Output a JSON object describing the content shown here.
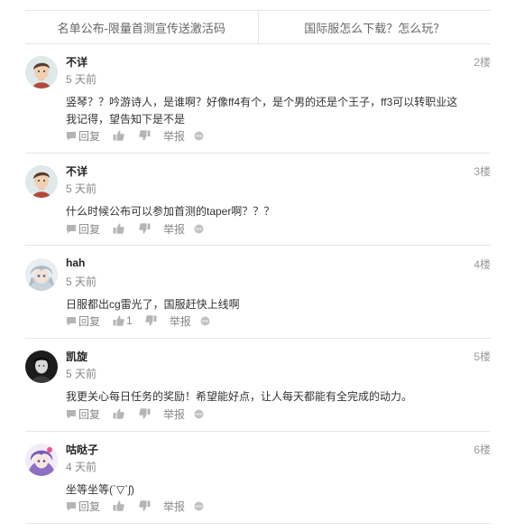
{
  "top_nav": {
    "left_link": "名单公布-限量首测宣传送激活码",
    "right_link": "国际服怎么下载？怎么玩？"
  },
  "comments": [
    {
      "username": "不详",
      "time": "5 天前",
      "floor": "2楼",
      "text": "竖琴？？吟游诗人，是谁啊？好像ff4有个，是个男的还是个王子，ff3可以转职业这我记得，望告知下是不是",
      "reply_label": "回复",
      "like_count": "",
      "report_label": "举报",
      "avatar_icon": "anime-boy-avatar"
    },
    {
      "username": "不详",
      "time": "5 天前",
      "floor": "3楼",
      "text": "什么时候公布可以参加首测的taper啊？？？",
      "reply_label": "回复",
      "like_count": "",
      "report_label": "举报",
      "avatar_icon": "anime-boy-avatar"
    },
    {
      "username": "hah",
      "time": "5 天前",
      "floor": "4楼",
      "text": "日服都出cg雷光了，国服赶快上线啊",
      "reply_label": "回复",
      "like_count": "1",
      "report_label": "举报",
      "avatar_icon": "silver-hair-avatar"
    },
    {
      "username": "凯旋",
      "time": "5 天前",
      "floor": "5楼",
      "text": "我更关心每日任务的奖励！希望能好点，让人每天都能有全完成的动力。",
      "reply_label": "回复",
      "like_count": "",
      "report_label": "举报",
      "avatar_icon": "dark-portrait-avatar"
    },
    {
      "username": "咕哒子",
      "time": "4 天前",
      "floor": "6楼",
      "text": "坐等坐等(´▽`ʃ)",
      "reply_label": "回复",
      "like_count": "",
      "report_label": "举报",
      "avatar_icon": "purple-anime-avatar"
    }
  ]
}
